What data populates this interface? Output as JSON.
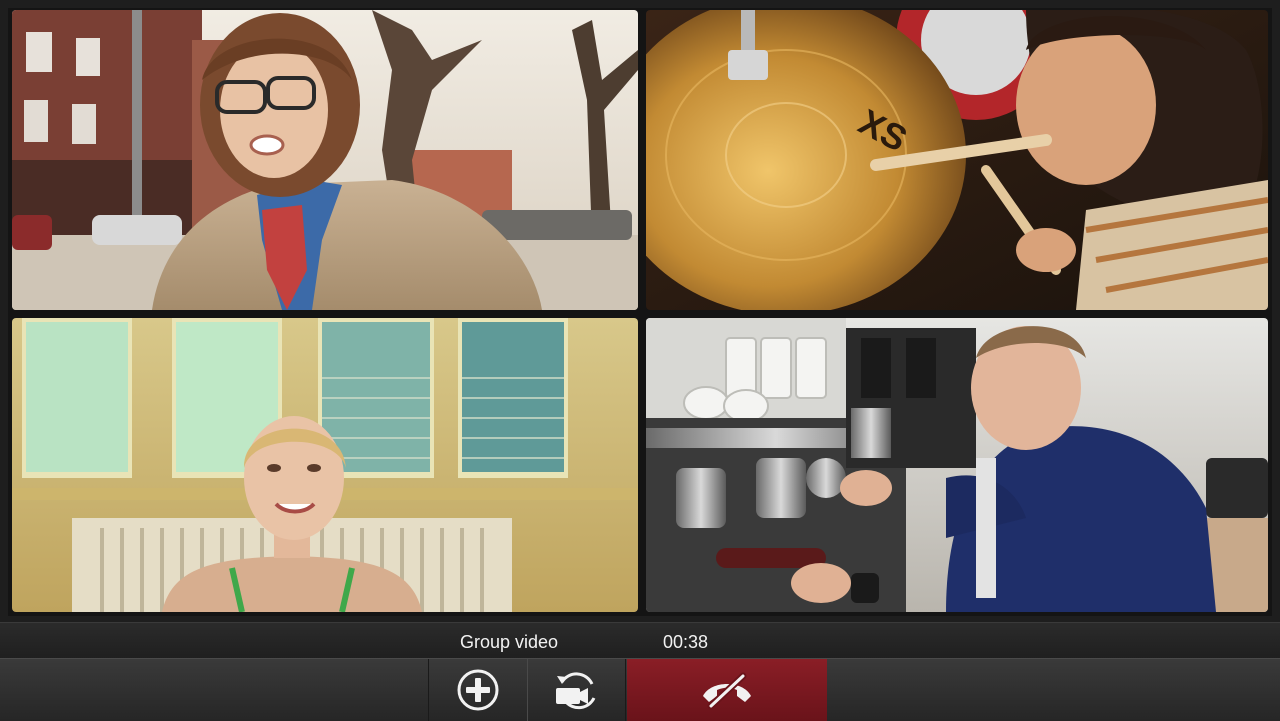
{
  "call": {
    "title": "Group video",
    "timer": "00:38"
  },
  "participants": [
    {
      "position": "top-left"
    },
    {
      "position": "top-right"
    },
    {
      "position": "bottom-left"
    },
    {
      "position": "bottom-right"
    }
  ],
  "toolbar": {
    "icons": {
      "add": "plus-circle-icon",
      "switch": "camera-switch-icon",
      "end": "hang-up-icon"
    },
    "colors": {
      "end_call": "#7a1820",
      "bar": "#2e2e2e"
    }
  }
}
